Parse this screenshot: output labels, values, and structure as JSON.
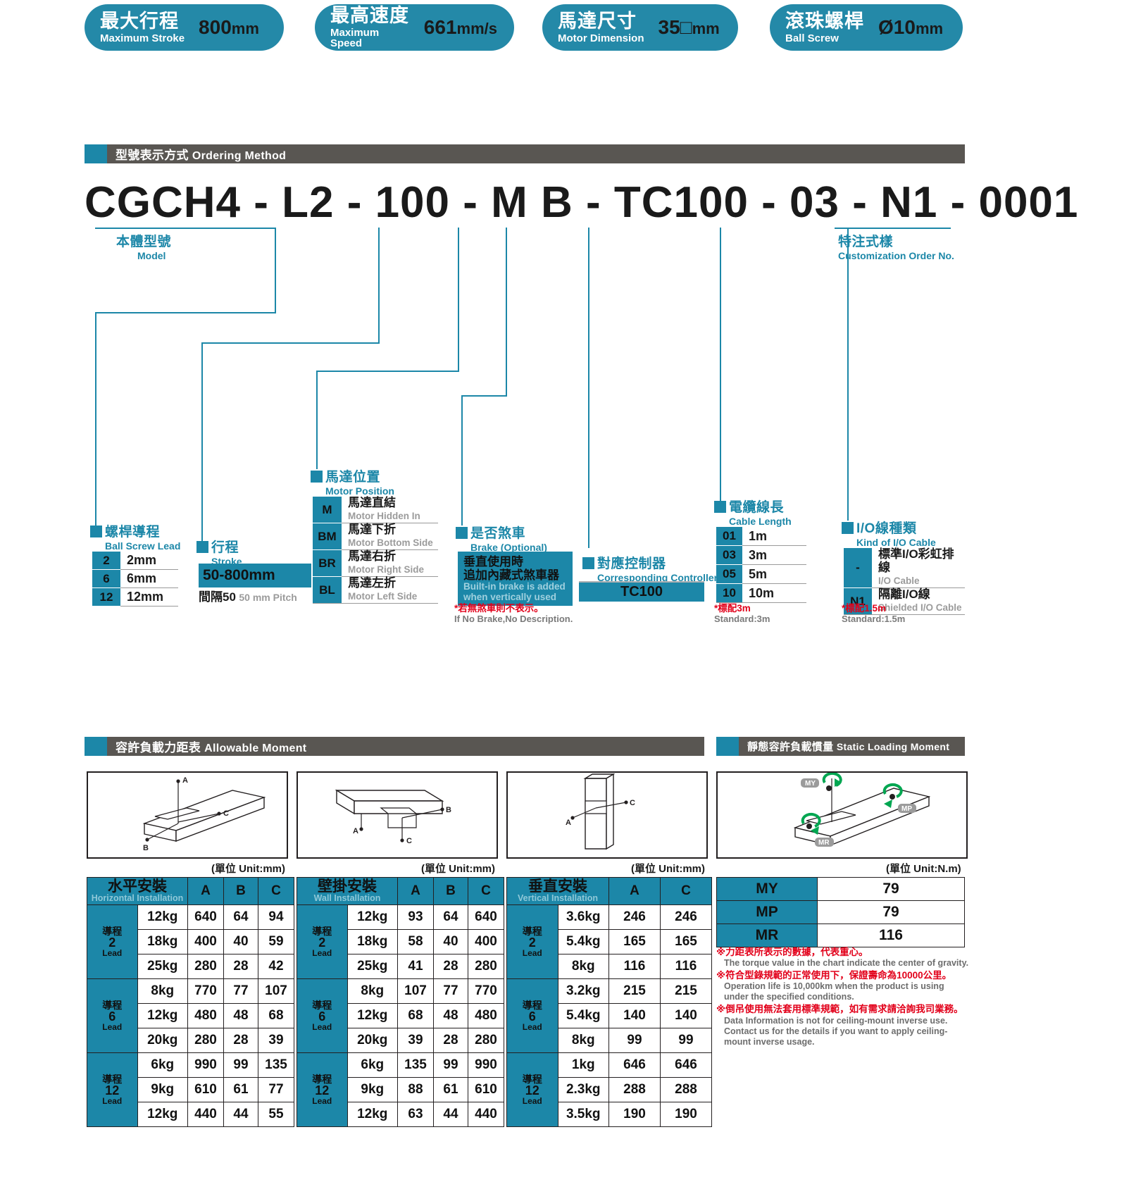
{
  "header_pills": [
    {
      "cn": "最大行程",
      "en": "Maximum Stroke",
      "value": "800",
      "unit": "mm",
      "name": "maximum-stroke"
    },
    {
      "cn": "最高速度",
      "en": "Maximum Speed",
      "value": "661",
      "unit": "mm/s",
      "name": "maximum-speed"
    },
    {
      "cn": "馬達尺寸",
      "en": "Motor Dimension",
      "value": "35□",
      "unit": "mm",
      "name": "motor-dimension"
    },
    {
      "cn": "滾珠螺桿",
      "en": "Ball Screw",
      "value": "Ø10",
      "unit": "mm",
      "name": "ball-screw"
    }
  ],
  "sections": {
    "ordering": {
      "cn": "型號表示方式",
      "en": "Ordering Method"
    },
    "allowable": {
      "cn": "容許負載力距表",
      "en": "Allowable Moment"
    },
    "static": {
      "cn": "靜態容許負載慣量",
      "en": "Static Loading Moment"
    }
  },
  "model_code": "CGCH4 - L2 - 100 - M B - TC100 - 03 - N1 - 0001",
  "callouts": {
    "model": {
      "cn": "本體型號",
      "en": "Model"
    },
    "custom": {
      "cn": "特注式樣",
      "en": "Customization Order No."
    }
  },
  "options": {
    "ball_screw_lead": {
      "cn": "螺桿導程",
      "en": "Ball Screw Lead",
      "rows": [
        {
          "key": "2",
          "label": "2mm"
        },
        {
          "key": "6",
          "label": "6mm"
        },
        {
          "key": "12",
          "label": "12mm"
        }
      ]
    },
    "stroke": {
      "cn": "行程",
      "en": "Stroke",
      "range": "50-800mm",
      "pitch_cn": "間隔50",
      "pitch_en": "50 mm Pitch"
    },
    "motor_position": {
      "cn": "馬達位置",
      "en": "Motor Position",
      "rows": [
        {
          "key": "M",
          "cn": "馬達直結",
          "en": "Motor Hidden In"
        },
        {
          "key": "BM",
          "cn": "馬達下折",
          "en": "Motor Bottom Side"
        },
        {
          "key": "BR",
          "cn": "馬達右折",
          "en": "Motor Right Side"
        },
        {
          "key": "BL",
          "cn": "馬達左折",
          "en": "Motor Left Side"
        }
      ]
    },
    "brake": {
      "cn": "是否煞車",
      "en": "Brake (Optional)",
      "box_cn_1": "垂直使用時",
      "box_cn_2": "追加內藏式煞車器",
      "box_en_1": "Built-in brake is added",
      "box_en_2": "when vertically used",
      "note_cn": "*若無煞車則不表示。",
      "note_en": "If No Brake,No Description."
    },
    "controller": {
      "cn": "對應控制器",
      "en": "Corresponding Controller",
      "value": "TC100"
    },
    "cable_length": {
      "cn": "電纜線長",
      "en": "Cable Length",
      "rows": [
        {
          "key": "01",
          "label": "1m"
        },
        {
          "key": "03",
          "label": "3m"
        },
        {
          "key": "05",
          "label": "5m"
        },
        {
          "key": "10",
          "label": "10m"
        }
      ],
      "note_cn": "*標配3m",
      "note_en": "Standard:3m"
    },
    "io_cable": {
      "cn": "I/O線種類",
      "en": "Kind of I/O Cable",
      "rows": [
        {
          "key": "-",
          "cn": "標準I/O彩虹排線",
          "en": "I/O Cable"
        },
        {
          "key": "N1",
          "cn": "隔離I/O線",
          "en": "Shielded I/O Cable"
        }
      ],
      "note_cn": "*標配1.5m",
      "note_en": "Standard:1.5m"
    }
  },
  "moment_tables": {
    "unit_mm": "(單位 Unit:mm)",
    "unit_nm": "(單位 Unit:N.m)",
    "horizontal": {
      "cn": "水平安裝",
      "en": "Horizontal Installation",
      "cols": [
        "A",
        "B",
        "C"
      ],
      "groups": [
        {
          "lead_cn": "導程",
          "lead_num": "2",
          "lead_en": "Lead",
          "rows": [
            {
              "load": "12kg",
              "values": [
                "640",
                "64",
                "94"
              ]
            },
            {
              "load": "18kg",
              "values": [
                "400",
                "40",
                "59"
              ]
            },
            {
              "load": "25kg",
              "values": [
                "280",
                "28",
                "42"
              ]
            }
          ]
        },
        {
          "lead_cn": "導程",
          "lead_num": "6",
          "lead_en": "Lead",
          "rows": [
            {
              "load": "8kg",
              "values": [
                "770",
                "77",
                "107"
              ]
            },
            {
              "load": "12kg",
              "values": [
                "480",
                "48",
                "68"
              ]
            },
            {
              "load": "20kg",
              "values": [
                "280",
                "28",
                "39"
              ]
            }
          ]
        },
        {
          "lead_cn": "導程",
          "lead_num": "12",
          "lead_en": "Lead",
          "rows": [
            {
              "load": "6kg",
              "values": [
                "990",
                "99",
                "135"
              ]
            },
            {
              "load": "9kg",
              "values": [
                "610",
                "61",
                "77"
              ]
            },
            {
              "load": "12kg",
              "values": [
                "440",
                "44",
                "55"
              ]
            }
          ]
        }
      ]
    },
    "wall": {
      "cn": "壁掛安裝",
      "en": "Wall Installation",
      "cols": [
        "A",
        "B",
        "C"
      ],
      "groups": [
        {
          "lead_cn": "導程",
          "lead_num": "2",
          "lead_en": "Lead",
          "rows": [
            {
              "load": "12kg",
              "values": [
                "93",
                "64",
                "640"
              ]
            },
            {
              "load": "18kg",
              "values": [
                "58",
                "40",
                "400"
              ]
            },
            {
              "load": "25kg",
              "values": [
                "41",
                "28",
                "280"
              ]
            }
          ]
        },
        {
          "lead_cn": "導程",
          "lead_num": "6",
          "lead_en": "Lead",
          "rows": [
            {
              "load": "8kg",
              "values": [
                "107",
                "77",
                "770"
              ]
            },
            {
              "load": "12kg",
              "values": [
                "68",
                "48",
                "480"
              ]
            },
            {
              "load": "20kg",
              "values": [
                "39",
                "28",
                "280"
              ]
            }
          ]
        },
        {
          "lead_cn": "導程",
          "lead_num": "12",
          "lead_en": "Lead",
          "rows": [
            {
              "load": "6kg",
              "values": [
                "135",
                "99",
                "990"
              ]
            },
            {
              "load": "9kg",
              "values": [
                "88",
                "61",
                "610"
              ]
            },
            {
              "load": "12kg",
              "values": [
                "63",
                "44",
                "440"
              ]
            }
          ]
        }
      ]
    },
    "vertical": {
      "cn": "垂直安裝",
      "en": "Vertical Installation",
      "cols": [
        "A",
        "C"
      ],
      "groups": [
        {
          "lead_cn": "導程",
          "lead_num": "2",
          "lead_en": "Lead",
          "rows": [
            {
              "load": "3.6kg",
              "values": [
                "246",
                "246"
              ]
            },
            {
              "load": "5.4kg",
              "values": [
                "165",
                "165"
              ]
            },
            {
              "load": "8kg",
              "values": [
                "116",
                "116"
              ]
            }
          ]
        },
        {
          "lead_cn": "導程",
          "lead_num": "6",
          "lead_en": "Lead",
          "rows": [
            {
              "load": "3.2kg",
              "values": [
                "215",
                "215"
              ]
            },
            {
              "load": "5.4kg",
              "values": [
                "140",
                "140"
              ]
            },
            {
              "load": "8kg",
              "values": [
                "99",
                "99"
              ]
            }
          ]
        },
        {
          "lead_cn": "導程",
          "lead_num": "12",
          "lead_en": "Lead",
          "rows": [
            {
              "load": "1kg",
              "values": [
                "646",
                "646"
              ]
            },
            {
              "load": "2.3kg",
              "values": [
                "288",
                "288"
              ]
            },
            {
              "load": "3.5kg",
              "values": [
                "190",
                "190"
              ]
            }
          ]
        }
      ]
    }
  },
  "static_loading": {
    "rows": [
      {
        "key": "MY",
        "value": "79"
      },
      {
        "key": "MP",
        "value": "79"
      },
      {
        "key": "MR",
        "value": "116"
      }
    ],
    "diagram_labels": [
      "MY",
      "MP",
      "MR"
    ],
    "notes": [
      {
        "cn": "※力距表所表示的數據，代表重心。",
        "en": "The torque value in the chart indicate the center of gravity."
      },
      {
        "cn": "※符合型錄規範的正常使用下，保證壽命為10000公里。",
        "en": "Operation life is 10,000km when the product is using under the specified conditions."
      },
      {
        "cn": "※倒吊使用無法套用標準規範，如有需求請洽詢我司業務。",
        "en": "Data Information is not for ceiling-mount inverse use. Contact us for the details if you want to apply ceiling-mount inverse usage."
      }
    ]
  },
  "colors": {
    "teal": "#1c87a8",
    "bar_gray": "#595652",
    "red": "#e2001a",
    "green": "#00a651"
  }
}
